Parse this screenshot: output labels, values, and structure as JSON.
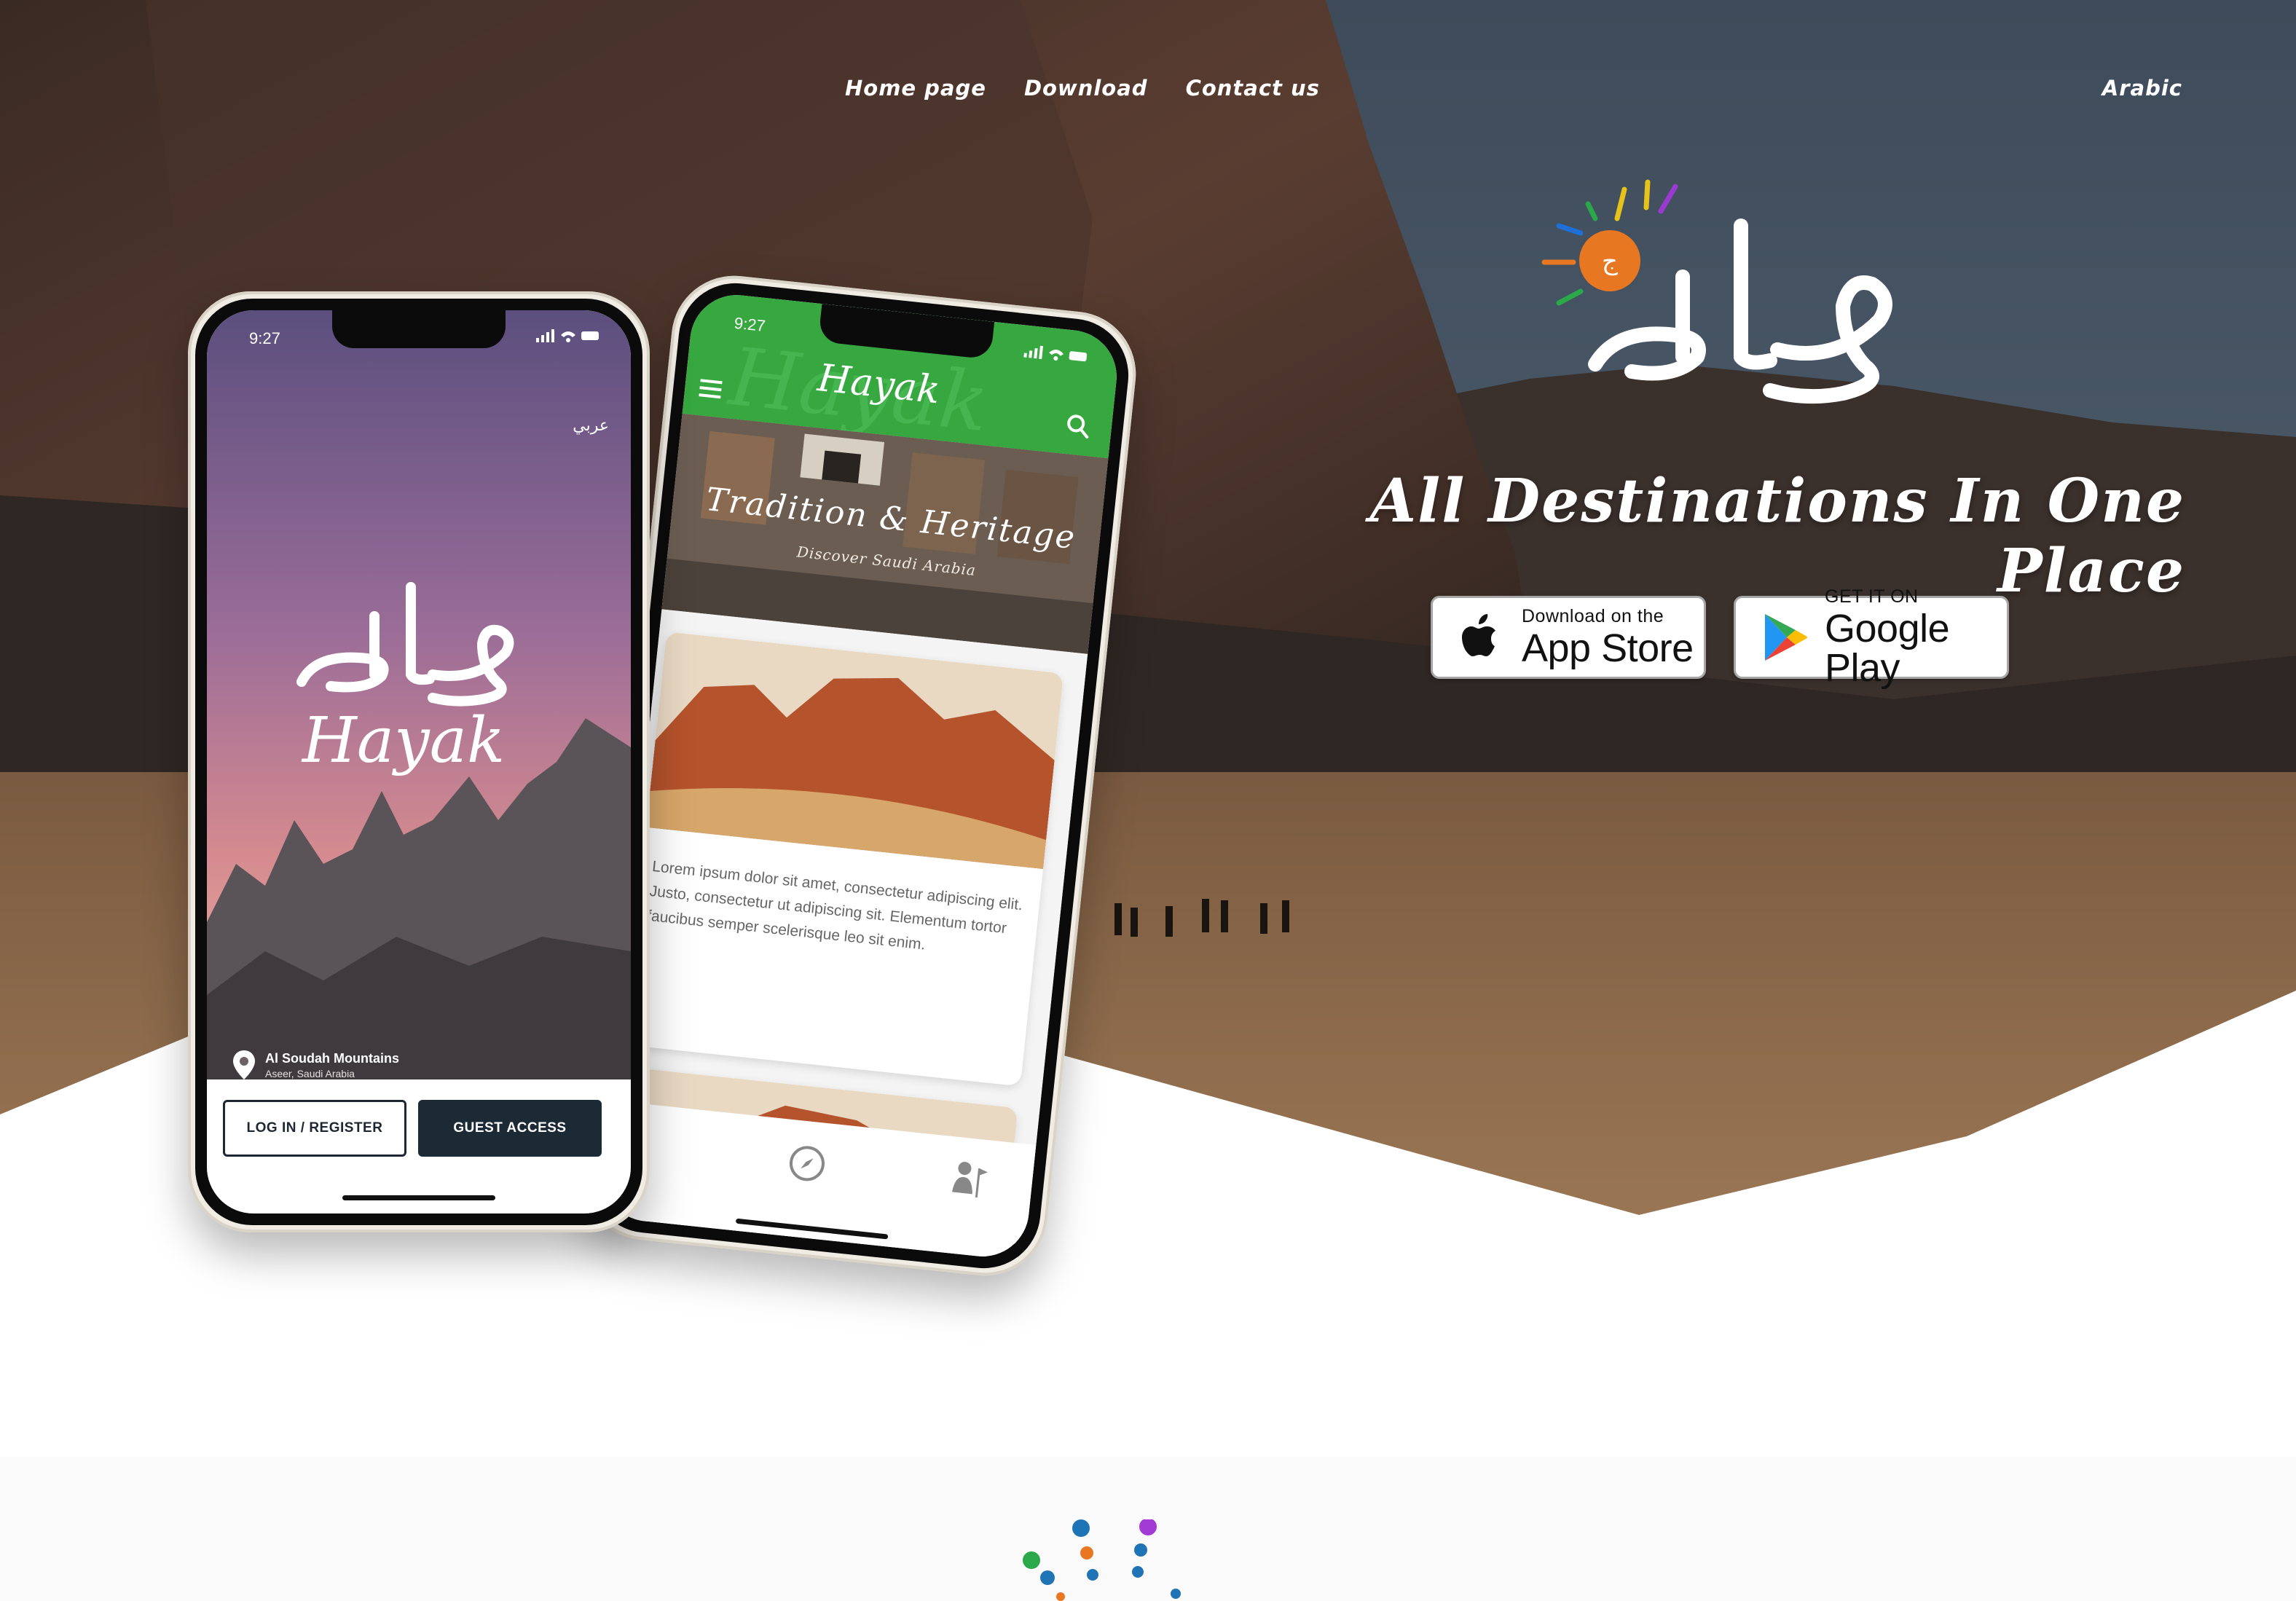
{
  "nav": {
    "items": [
      {
        "label": "Home page"
      },
      {
        "label": "Download"
      },
      {
        "label": "Contact us"
      }
    ],
    "language_label": "Arabic"
  },
  "hero": {
    "tagline": "All Destinations In One Place",
    "logo_text": "حيّاك",
    "app_store": {
      "small": "Download on the",
      "big": "App Store"
    },
    "google_play": {
      "small": "GET IT ON",
      "big": "Google Play"
    }
  },
  "phone_front": {
    "time": "9:27",
    "language_toggle": "عربي",
    "logo_arabic": "حيّاك",
    "logo_latin": "Hayak",
    "location_title": "Al Soudah Mountains",
    "location_subtitle": "Aseer, Saudi Arabia",
    "login_label": "LOG IN / REGISTER",
    "guest_label": "GUEST ACCESS"
  },
  "phone_back": {
    "time": "9:27",
    "brand": "Hayak",
    "banner_title": "Tradition & Heritage",
    "banner_subtitle": "Discover Saudi Arabia",
    "card_text": "Lorem ipsum dolor sit amet, consectetur adipiscing elit. Justo, consectetur ut adipiscing sit. Elementum tortor faucibus semper scelerisque leo sit enim."
  },
  "colors": {
    "brand_orange": "#e87722",
    "header_green": "#36a83f",
    "button_dark": "#1c2a36"
  }
}
